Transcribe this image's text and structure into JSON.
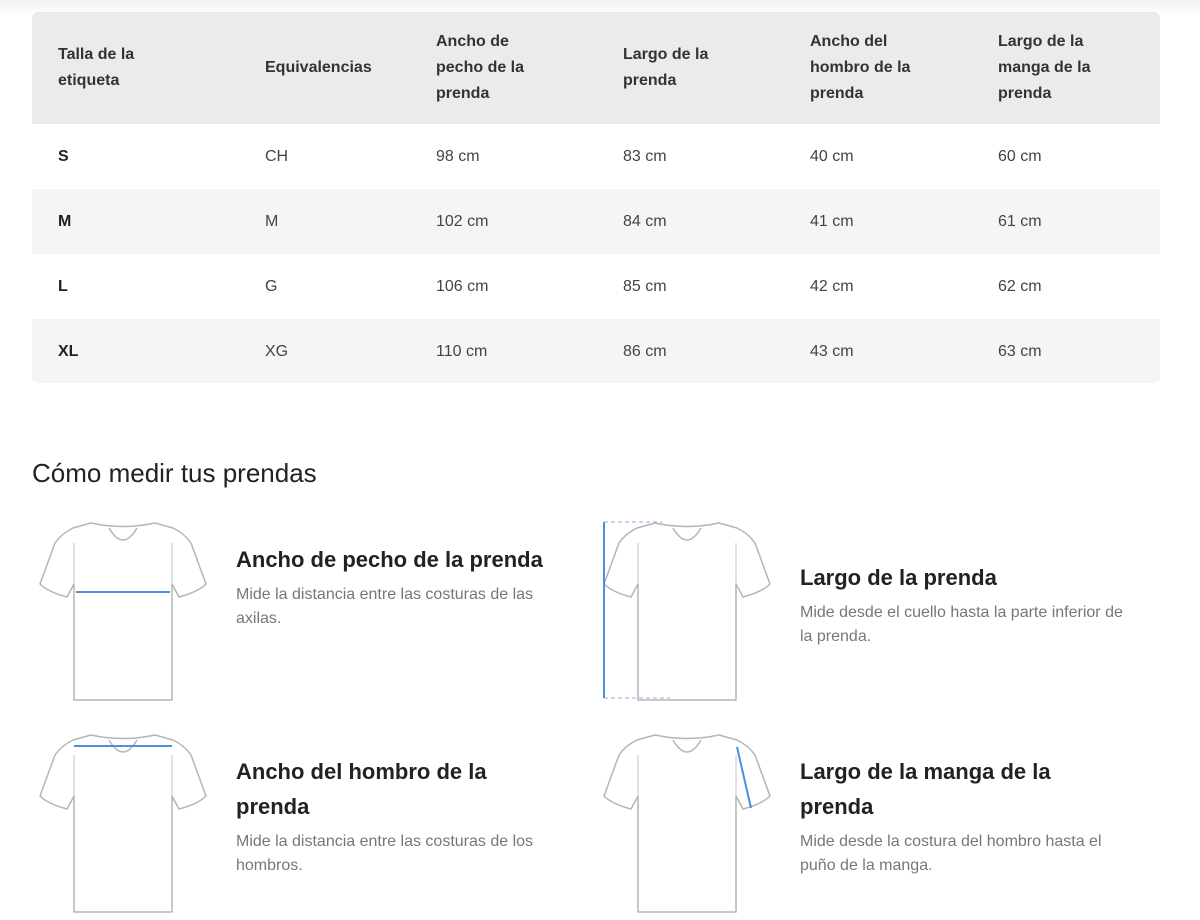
{
  "size_table": {
    "headers": [
      "Talla de la etiqueta",
      "Equivalencias",
      "Ancho de pecho de la prenda",
      "Largo de la prenda",
      "Ancho del hombro de la prenda",
      "Largo de la manga de la prenda"
    ],
    "rows": [
      [
        "S",
        "CH",
        "98 cm",
        "83 cm",
        "40 cm",
        "60 cm"
      ],
      [
        "M",
        "M",
        "102 cm",
        "84 cm",
        "41 cm",
        "61 cm"
      ],
      [
        "L",
        "G",
        "106 cm",
        "85 cm",
        "42 cm",
        "62 cm"
      ],
      [
        "XL",
        "XG",
        "110 cm",
        "86 cm",
        "43 cm",
        "63 cm"
      ]
    ]
  },
  "how_to_measure": {
    "title": "Cómo medir tus prendas",
    "items": [
      {
        "title": "Ancho de pecho de la prenda",
        "description": "Mide la distancia entre las costuras de las axilas.",
        "icon": "tshirt-chest-icon"
      },
      {
        "title": "Largo de la prenda",
        "description": "Mide desde el cuello hasta la parte inferior de la prenda.",
        "icon": "tshirt-length-icon"
      },
      {
        "title": "Ancho del hombro de la prenda",
        "description": "Mide la distancia entre las costuras de los hombros.",
        "icon": "tshirt-shoulder-icon"
      },
      {
        "title": "Largo de la manga de la prenda",
        "description": "Mide desde la costura del hombro hasta el puño de la manga.",
        "icon": "tshirt-sleeve-icon"
      }
    ]
  },
  "colors": {
    "header_bg": "#ebebeb",
    "row_alt_bg": "#f5f5f5",
    "measure_line": "#4a90e2",
    "shirt_outline": "#b5b5b5"
  }
}
